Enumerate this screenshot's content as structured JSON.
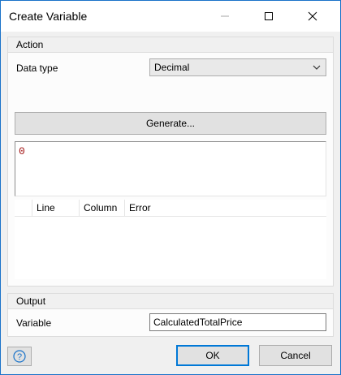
{
  "window": {
    "title": "Create Variable"
  },
  "action": {
    "group_title": "Action",
    "data_type_label": "Data type",
    "data_type_value": "Decimal",
    "generate_label": "Generate...",
    "expression": "0",
    "error_columns": [
      "Line",
      "Column",
      "Error"
    ]
  },
  "output": {
    "group_title": "Output",
    "variable_label": "Variable",
    "variable_value": "CalculatedTotalPrice"
  },
  "buttons": {
    "ok": "OK",
    "cancel": "Cancel"
  },
  "colors": {
    "accent": "#0078d7",
    "expression_text": "#a31515",
    "help_icon": "#1a73c9"
  },
  "icons": {
    "minimize": "minimize-icon",
    "maximize": "maximize-icon",
    "close": "close-icon",
    "dropdown": "chevron-down-icon",
    "help": "help-icon"
  }
}
